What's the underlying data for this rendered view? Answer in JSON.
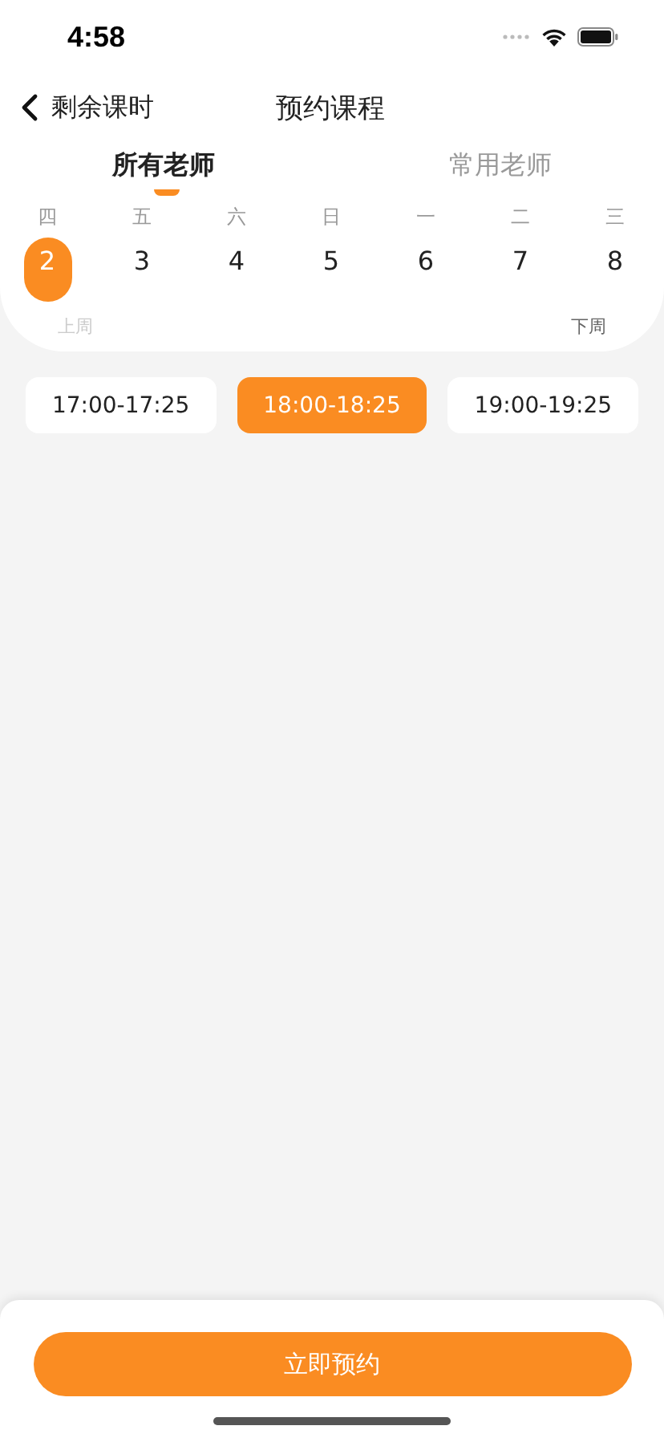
{
  "status_bar": {
    "time": "4:58"
  },
  "nav": {
    "back_label": "剩余课时",
    "title": "预约课程"
  },
  "tabs": [
    {
      "label": "所有老师",
      "selected": true
    },
    {
      "label": "常用老师",
      "selected": false
    }
  ],
  "days": [
    {
      "weekday": "四",
      "date": "2",
      "selected": true
    },
    {
      "weekday": "五",
      "date": "3",
      "selected": false
    },
    {
      "weekday": "六",
      "date": "4",
      "selected": false
    },
    {
      "weekday": "日",
      "date": "5",
      "selected": false
    },
    {
      "weekday": "一",
      "date": "6",
      "selected": false
    },
    {
      "weekday": "二",
      "date": "7",
      "selected": false
    },
    {
      "weekday": "三",
      "date": "8",
      "selected": false
    }
  ],
  "week_nav": {
    "prev": {
      "label": "上周",
      "disabled": true
    },
    "next": {
      "label": "下周",
      "disabled": false
    }
  },
  "time_slots": [
    {
      "label": "17:00-17:25",
      "selected": false
    },
    {
      "label": "18:00-18:25",
      "selected": true
    },
    {
      "label": "19:00-19:25",
      "selected": false
    }
  ],
  "action_button": "立即预约"
}
